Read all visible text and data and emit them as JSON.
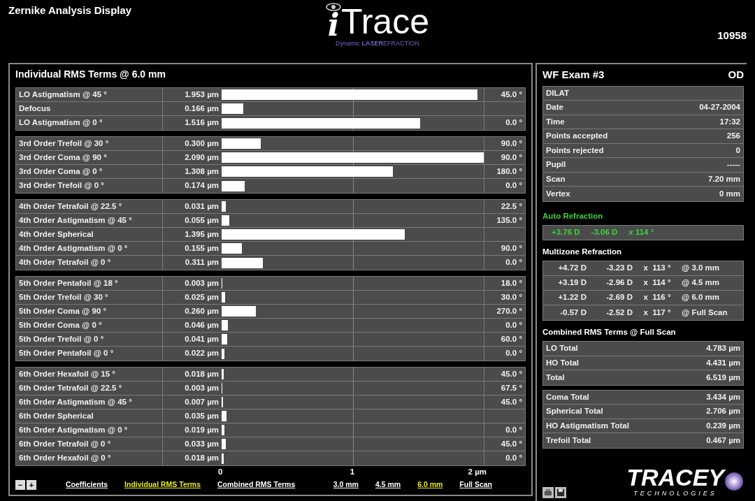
{
  "window": {
    "title": "Zernike Analysis Display",
    "number": "10958"
  },
  "logo": {
    "name": "Trace",
    "letter": "i",
    "tagline": "Dynamic **LASER**EFRACTION"
  },
  "rms_panel": {
    "title": "Individual RMS Terms @ 6.0 mm",
    "groups": [
      {
        "rows": [
          {
            "name": "LO Astigmatism @ 45 °",
            "value": "1.953 µm",
            "level": 0.977,
            "angle": "45.0 °"
          },
          {
            "name": "Defocus",
            "value": "0.166 µm",
            "level": 0.083
          },
          {
            "name": "LO Astigmatism @ 0 °",
            "value": "1.516 µm",
            "level": 0.758,
            "angle": "0.0 °"
          }
        ]
      },
      {
        "rows": [
          {
            "name": "3rd Order Trefoil @ 30 °",
            "value": "0.300 µm",
            "level": 0.15,
            "angle": "90.0 °"
          },
          {
            "name": "3rd Order Coma @ 90 °",
            "value": "2.090 µm",
            "level": 1,
            "angle": "90.0 °"
          },
          {
            "name": "3rd Order Coma @ 0 °",
            "value": "1.308 µm",
            "level": 0.654,
            "angle": "180.0 °"
          },
          {
            "name": "3rd Order Trefoil @ 0 °",
            "value": "0.174 µm",
            "level": 0.087,
            "angle": "0.0 °"
          }
        ]
      },
      {
        "rows": [
          {
            "name": "4th Order Tetrafoil @ 22.5 °",
            "value": "0.031 µm",
            "level": 0.016,
            "angle": "22.5 °"
          },
          {
            "name": "4th Order Astigmatism @ 45 °",
            "value": "0.055 µm",
            "level": 0.028,
            "angle": "135.0 °"
          },
          {
            "name": "4th Order Spherical",
            "value": "1.395 µm",
            "level": 0.698
          },
          {
            "name": "4th Order Astigmatism @ 0 °",
            "value": "0.155 µm",
            "level": 0.078,
            "angle": "90.0 °"
          },
          {
            "name": "4th Order Tetrafoil @ 0 °",
            "value": "0.311 µm",
            "level": 0.156,
            "angle": "0.0 °"
          }
        ]
      },
      {
        "rows": [
          {
            "name": "5th Order Pentafoil @ 18 °",
            "value": "0.003 µm",
            "level": 0.002,
            "angle": "18.0 °"
          },
          {
            "name": "5th Order Trefoil @ 30 °",
            "value": "0.025 µm",
            "level": 0.013,
            "angle": "30.0 °"
          },
          {
            "name": "5th Order Coma @ 90 °",
            "value": "0.260 µm",
            "level": 0.13,
            "angle": "270.0 °"
          },
          {
            "name": "5th Order Coma @ 0 °",
            "value": "0.046 µm",
            "level": 0.023,
            "angle": "0.0 °"
          },
          {
            "name": "5th Order Trefoil @ 0 °",
            "value": "0.041 µm",
            "level": 0.021,
            "angle": "60.0 °"
          },
          {
            "name": "5th Order Pentafoil @ 0 °",
            "value": "0.022 µm",
            "level": 0.011,
            "angle": "0.0 °"
          }
        ]
      },
      {
        "rows": [
          {
            "name": "6th Order Hexafoil @ 15 °",
            "value": "0.018 µm",
            "level": 0.009,
            "angle": "45.0 °"
          },
          {
            "name": "6th Order Tetrafoil @ 22.5 °",
            "value": "0.003 µm",
            "level": 0.002,
            "angle": "67.5 °"
          },
          {
            "name": "6th Order Astigmatism @ 45 °",
            "value": "0.007 µm",
            "level": 0.004,
            "angle": "45.0 °"
          },
          {
            "name": "6th Order Spherical",
            "value": "0.035 µm",
            "level": 0.018
          },
          {
            "name": "6th Order Astigmatism @ 0 °",
            "value": "0.019 µm",
            "level": 0.01,
            "angle": "0.0 °"
          },
          {
            "name": "6th Order Tetrafoil @ 0 °",
            "value": "0.033 µm",
            "level": 0.017,
            "angle": "45.0 °"
          },
          {
            "name": "6th Order Hexafoil @ 0 °",
            "value": "0.018 µm",
            "level": 0.009,
            "angle": "0.0 °"
          }
        ]
      }
    ],
    "axis": [
      "0",
      "1",
      "2 µm"
    ],
    "zoom_buttons": [
      "−",
      "+"
    ],
    "views": [
      {
        "label": "Coefficients",
        "selected": false
      },
      {
        "label": "Individual RMS Terms",
        "selected": true
      },
      {
        "label": "Combined RMS Terms",
        "selected": false
      }
    ],
    "zones": [
      {
        "label": "3.0 mm",
        "selected": false
      },
      {
        "label": "4.5 mm",
        "selected": false
      },
      {
        "label": "6.0 mm",
        "selected": true
      },
      {
        "label": "Full Scan",
        "selected": false
      }
    ]
  },
  "exam": {
    "title": "WF Exam #3",
    "eye": "OD",
    "info": [
      {
        "label": "DILAT"
      },
      {
        "label": "Date",
        "value": "04-27-2004"
      },
      {
        "label": "Time",
        "value": "17:32"
      },
      {
        "label": "Points accepted",
        "value": "256"
      },
      {
        "label": "Points rejected",
        "value": "0"
      },
      {
        "label": "Pupil",
        "value": "-----"
      },
      {
        "label": "Scan",
        "value": "7.20 mm"
      },
      {
        "label": "Vertex",
        "value": "0 mm"
      }
    ],
    "auto_refraction": {
      "title": "Auto Refraction",
      "values": [
        "+3.76 D",
        "-3.06 D",
        "x 114 °"
      ]
    },
    "multizone": {
      "title": "Multizone Refraction",
      "rows": [
        [
          "+4.72 D",
          "-3.23 D",
          "x  113 °",
          "@ 3.0 mm"
        ],
        [
          "+3.19 D",
          "-2.96 D",
          "x  114 °",
          "@ 4.5 mm"
        ],
        [
          "+1.22 D",
          "-2.69 D",
          "x  116 °",
          "@ 6.0 mm"
        ],
        [
          "-0.57 D",
          "-2.52 D",
          "x  117 °",
          "@ Full Scan"
        ]
      ]
    },
    "combined": {
      "title": "Combined RMS Terms @ Full Scan",
      "groups": [
        [
          {
            "label": "LO Total",
            "value": "4.783 µm"
          },
          {
            "label": "HO Total",
            "value": "4.431 µm"
          },
          {
            "label": "Total",
            "value": "6.519 µm"
          }
        ],
        [
          {
            "label": "Coma Total",
            "value": "3.434 µm"
          },
          {
            "label": "Spherical Total",
            "value": "2.706 µm"
          },
          {
            "label": "HO Astigmatism Total",
            "value": "0.239 µm"
          },
          {
            "label": "Trefoil Total",
            "value": "0.467 µm"
          }
        ]
      ]
    }
  },
  "brand": {
    "name": "TRACEY",
    "sub": "TECHNOLOGIES"
  }
}
